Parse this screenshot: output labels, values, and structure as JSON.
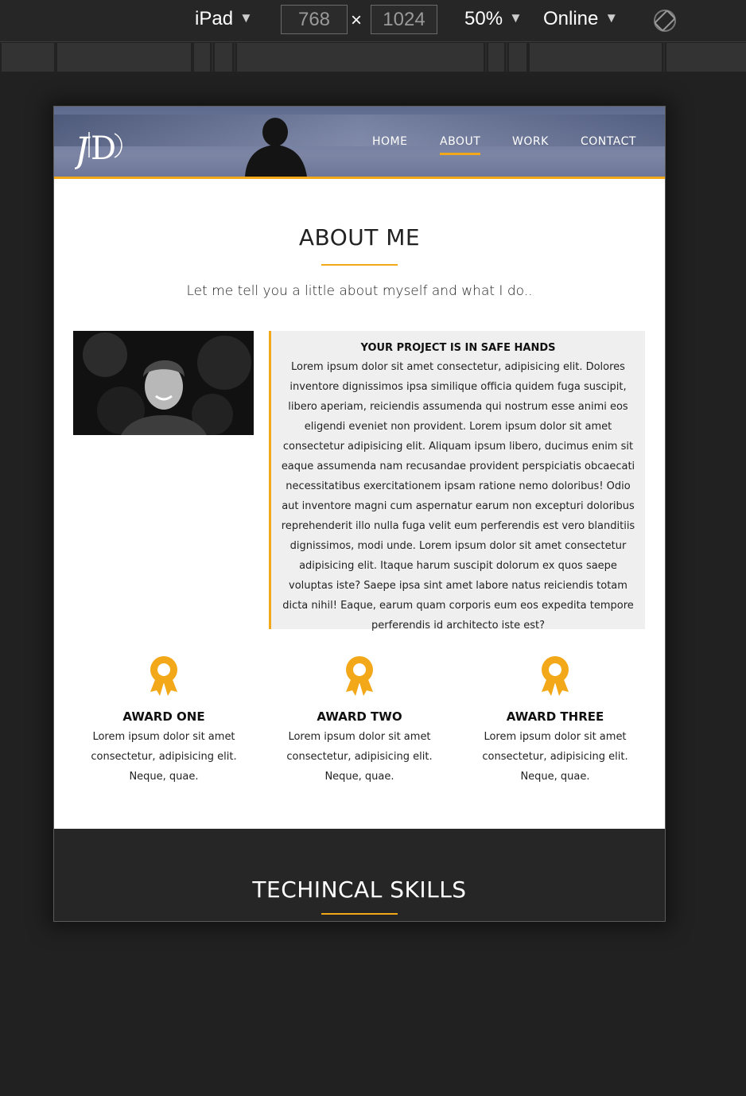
{
  "toolbar": {
    "device": "iPad",
    "width": "768",
    "height": "1024",
    "times": "×",
    "zoom": "50%",
    "network": "Online",
    "dropdown_arrow": "▼"
  },
  "site": {
    "logo_text": "JD",
    "nav": [
      "HOME",
      "ABOUT",
      "WORK",
      "CONTACT"
    ],
    "active_nav": "ABOUT",
    "accent_color": "#f3a81a"
  },
  "about": {
    "title": "ABOUT ME",
    "subtitle": "Let me tell you a little about myself and what I do..",
    "box_title": "YOUR PROJECT IS IN SAFE HANDS",
    "box_body": "Lorem ipsum dolor sit amet consectetur, adipisicing elit. Dolores inventore dignissimos ipsa similique officia quidem fuga suscipit, libero aperiam, reiciendis assumenda qui nostrum esse animi eos eligendi eveniet non provident. Lorem ipsum dolor sit amet consectetur adipisicing elit. Aliquam ipsum libero, ducimus enim sit eaque assumenda nam recusandae provident perspiciatis obcaecati necessitatibus exercitationem ipsam ratione nemo doloribus! Odio aut inventore magni cum aspernatur earum non excepturi doloribus reprehenderit illo nulla fuga velit eum perferendis est vero blanditiis dignissimos, modi unde. Lorem ipsum dolor sit amet consectetur adipisicing elit. Itaque harum suscipit dolorum ex quos saepe voluptas iste? Saepe ipsa sint amet labore natus reiciendis totam dicta nihil! Eaque, earum quam corporis eum eos expedita tempore perferendis id architecto iste est?"
  },
  "awards": [
    {
      "title": "AWARD ONE",
      "text": "Lorem ipsum dolor sit amet consectetur, adipisicing elit. Neque, quae.",
      "icon": "award-ribbon-icon"
    },
    {
      "title": "AWARD TWO",
      "text": "Lorem ipsum dolor sit amet consectetur, adipisicing elit. Neque, quae.",
      "icon": "award-ribbon-icon"
    },
    {
      "title": "AWARD THREE",
      "text": "Lorem ipsum dolor sit amet consectetur, adipisicing elit. Neque, quae.",
      "icon": "award-ribbon-icon"
    }
  ],
  "skills": {
    "title": "TECHINCAL SKILLS"
  }
}
